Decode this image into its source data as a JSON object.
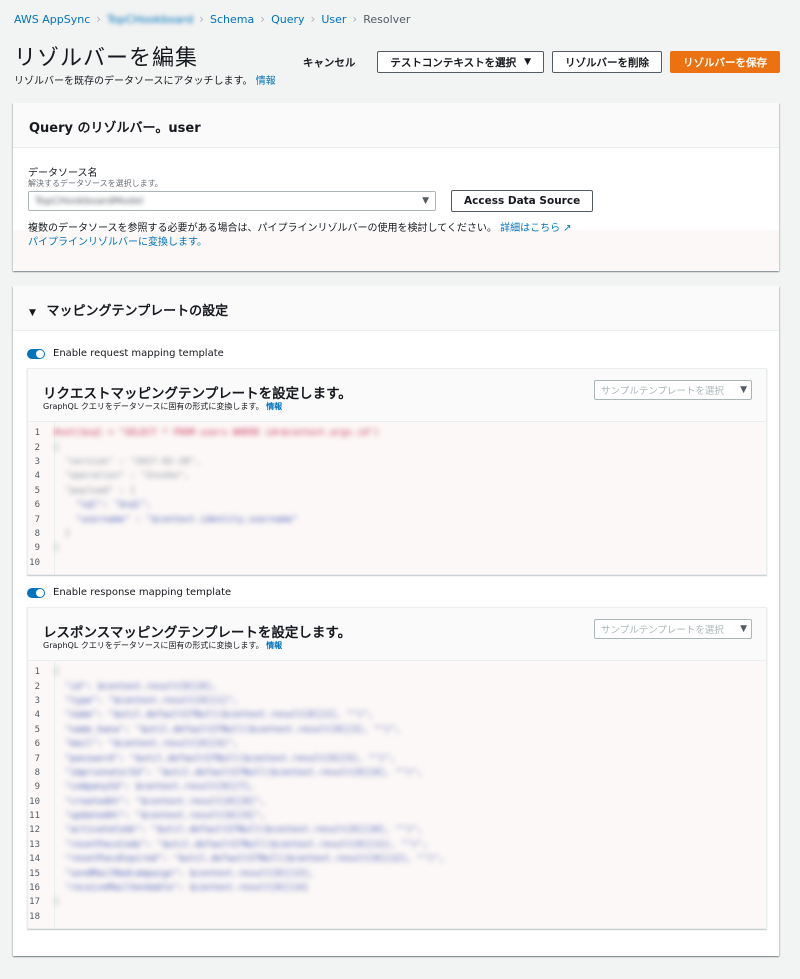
{
  "breadcrumb": {
    "items": [
      "AWS AppSync",
      "TopCHookboard",
      "Schema",
      "Query",
      "User",
      "Resolver"
    ]
  },
  "header": {
    "title": "リゾルバーを編集",
    "description": "リゾルバーを既存のデータソースにアタッチします。",
    "info_link": "情報",
    "cancel_label": "キャンセル",
    "test_context_label": "テストコンテキストを選択",
    "delete_label": "リゾルバーを削除",
    "save_label": "リゾルバーを保存"
  },
  "resolver_panel": {
    "title": "Query のリゾルバー。user",
    "datasource_label": "データソース名",
    "datasource_hint": "解決するデータソースを選択します。",
    "datasource_value": "TopCHookboardModel",
    "access_button": "Access Data Source",
    "info_text": "複数のデータソースを参照する必要がある場合は、パイプラインリゾルバーの使用を検討してください。",
    "details_link": "詳細はこちら",
    "convert_link": "パイプラインリゾルバーに変換します。"
  },
  "mapping_panel": {
    "title": "マッピングテンプレートの設定",
    "request_toggle_label": "Enable request mapping template",
    "response_toggle_label": "Enable response mapping template",
    "request": {
      "title": "リクエストマッピングテンプレートを設定します。",
      "subtitle": "GraphQL クエリをデータソースに固有の形式に変換します。",
      "info_link": "情報",
      "sample_placeholder": "サンプルテンプレートを選択",
      "line_numbers": [
        "1",
        "2",
        "3",
        "4",
        "5",
        "6",
        "7",
        "8",
        "9",
        "10"
      ],
      "lines": [
        "#set($sql = \"SELECT * FROM users WHERE id=$context.args.id\")",
        "{",
        "  \"version\" : \"2017-02-28\",",
        "  \"operation\" : \"Invoke\",",
        "  \"payload\" : {",
        "    \"sql\": \"$sql\",",
        "    \"username\" : \"$context.identity.username\"",
        "  }",
        "}",
        ""
      ]
    },
    "response": {
      "title": "レスポンスマッピングテンプレートを設定します。",
      "subtitle": "GraphQL クエリをデータソースに固有の形式に変換します。",
      "info_link": "情報",
      "sample_placeholder": "サンプルテンプレートを選択",
      "line_numbers": [
        "1",
        "2",
        "3",
        "4",
        "5",
        "6",
        "7",
        "8",
        "9",
        "10",
        "11",
        "12",
        "13",
        "14",
        "15",
        "16",
        "17",
        "18"
      ],
      "lines": [
        "{",
        "  \"id\": $context.result[0][0],",
        "  \"type\": \"$context.result[0][1]\",",
        "  \"name\": \"$util.defaultIfNull($context.result[0][2], \"\")\",",
        "  \"name_kana\": \"$util.defaultIfNull($context.result[0][3], \"\")\",",
        "  \"mail\": \"$context.result[0][4]\",",
        "  \"password\": \"$util.defaultIfNull($context.result[0][5], \"\")\",",
        "  \"imprsonatorId\": \"$util.defaultIfNull($context.result[0][6], \"\")\",",
        "  \"companyId\": $context.result[0][7],",
        "  \"createdAt\": \"$context.result[0][8]\",",
        "  \"updatedAt\": \"$context.result[0][9]\",",
        "  \"activateCode\": \"$util.defaultIfNull($context.result[0][10], \"\")\",",
        "  \"resetPassCode\": \"$util.defaultIfNull($context.result[0][11], \"\")\",",
        "  \"resetPassExpired\": \"$util.defaultIfNull($context.result[0][12], \"\")\",",
        "  \"sendMailMadcampaign\": $context.result[0][13],",
        "  \"receiveMailSendable\": $context.result[0][14]",
        "}",
        ""
      ]
    }
  }
}
